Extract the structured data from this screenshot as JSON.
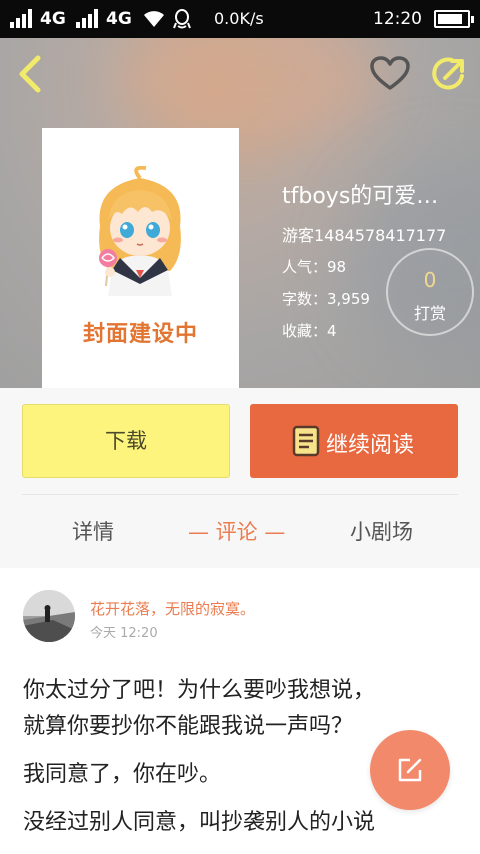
{
  "status_bar": {
    "network1": "4G",
    "network2": "4G",
    "speed": "0.0K/s",
    "time": "12:20",
    "battery_level": 0.85
  },
  "header_icons": [
    "back-icon",
    "heart-icon",
    "share-icon"
  ],
  "book": {
    "cover_caption": "封面建设中",
    "title": "tfboys的可爱…",
    "author": "游客1484578417177",
    "popularity": "人气：98",
    "word_count": "字数：3,959",
    "favorites": "收藏：4",
    "tip_count": "0",
    "tip_label": "打赏"
  },
  "actions": {
    "download": "下载",
    "continue_reading": "继续阅读"
  },
  "tabs": [
    {
      "label": "详情"
    },
    {
      "label": "— 评论 —"
    },
    {
      "label": "小剧场"
    }
  ],
  "comment": {
    "user": "花开花落，无限的寂寞。",
    "time": "今天 12:20",
    "lines": [
      "你太过分了吧！为什么要吵我想说，",
      "就算你要抄你不能跟我说一声吗？",
      "我同意了，你在吵。",
      "没经过别人同意，叫抄袭别人的小说"
    ]
  },
  "colors": {
    "accent": "#e8693f",
    "download_bg": "#fdf47e",
    "tab_active": "#ea7c4f",
    "fab": "#f2896a"
  }
}
